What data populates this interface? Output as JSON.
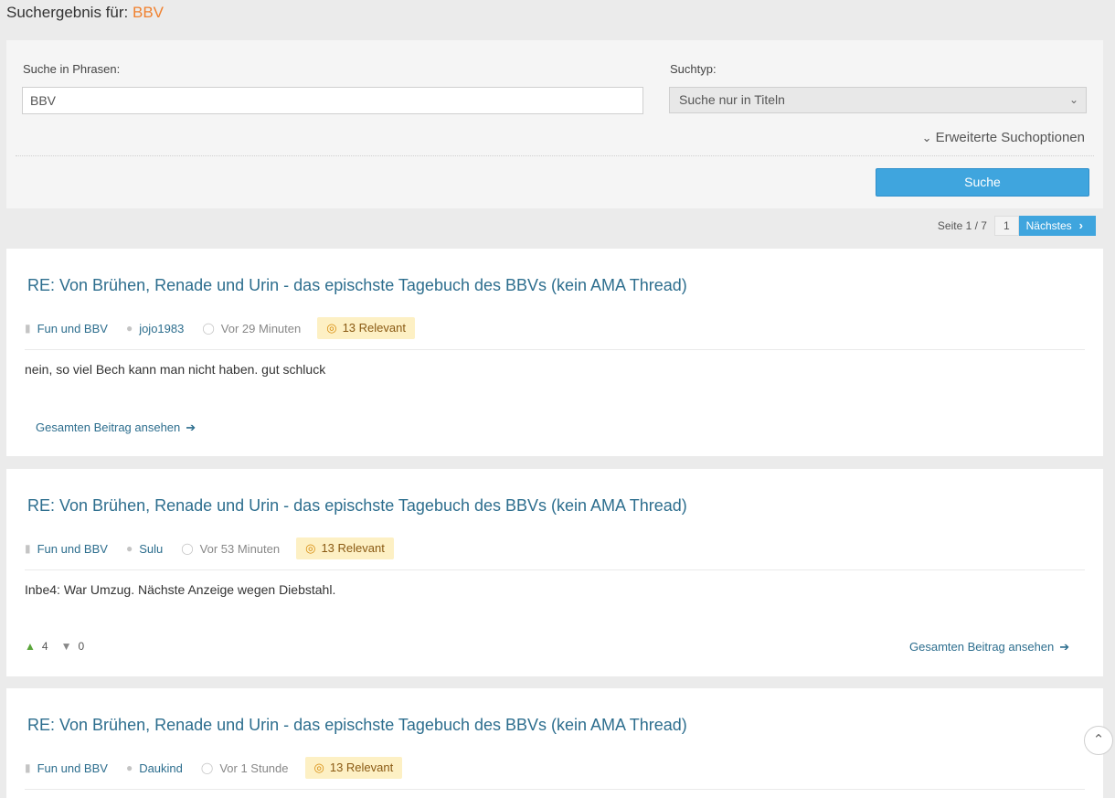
{
  "header": {
    "prefix": "Suchergebnis für:",
    "query": "BBV"
  },
  "search": {
    "phrase_label": "Suche in Phrasen:",
    "phrase_value": "BBV",
    "type_label": "Suchtyp:",
    "type_value": "Suche nur in Titeln",
    "advanced_label": "Erweiterte Suchoptionen",
    "button_label": "Suche"
  },
  "pagination": {
    "info": "Seite 1 / 7",
    "current": "1",
    "next_label": "Nächstes"
  },
  "results": [
    {
      "title": "RE: Von Brühen, Renade und Urin - das epischste Tagebuch des BBVs (kein AMA Thread)",
      "forum": "Fun und BBV",
      "author": "jojo1983",
      "time": "Vor 29 Minuten",
      "relevance": "13 Relevant",
      "excerpt": "nein, so viel Bech kann man nicht haben. gut schluck",
      "view_label": "Gesamten Beitrag ansehen"
    },
    {
      "title": "RE: Von Brühen, Renade und Urin - das epischste Tagebuch des BBVs (kein AMA Thread)",
      "forum": "Fun und BBV",
      "author": "Sulu",
      "time": "Vor 53 Minuten",
      "relevance": "13 Relevant",
      "excerpt": "Inbe4: War Umzug. Nächste Anzeige wegen Diebstahl.",
      "likes": "4",
      "dislikes": "0",
      "view_label": "Gesamten Beitrag ansehen"
    },
    {
      "title": "RE: Von Brühen, Renade und Urin - das epischste Tagebuch des BBVs (kein AMA Thread)",
      "forum": "Fun und BBV",
      "author": "Daukind",
      "time": "Vor 1 Stunde",
      "relevance": "13 Relevant"
    }
  ],
  "icons": {
    "folder": "folder-icon",
    "user": "user-icon",
    "clock": "clock-icon",
    "target": "target-icon",
    "arrow": "arrow-right-icon",
    "thumbs_up": "thumbs-up-icon",
    "thumbs_down": "thumbs-down-icon",
    "scroll_top": "chevron-up-icon"
  },
  "colors": {
    "accent": "#3fa5de",
    "query": "#f0812f",
    "link": "#2d6e8e",
    "badge_bg": "#fdf0c4",
    "like": "#5aa53a"
  }
}
